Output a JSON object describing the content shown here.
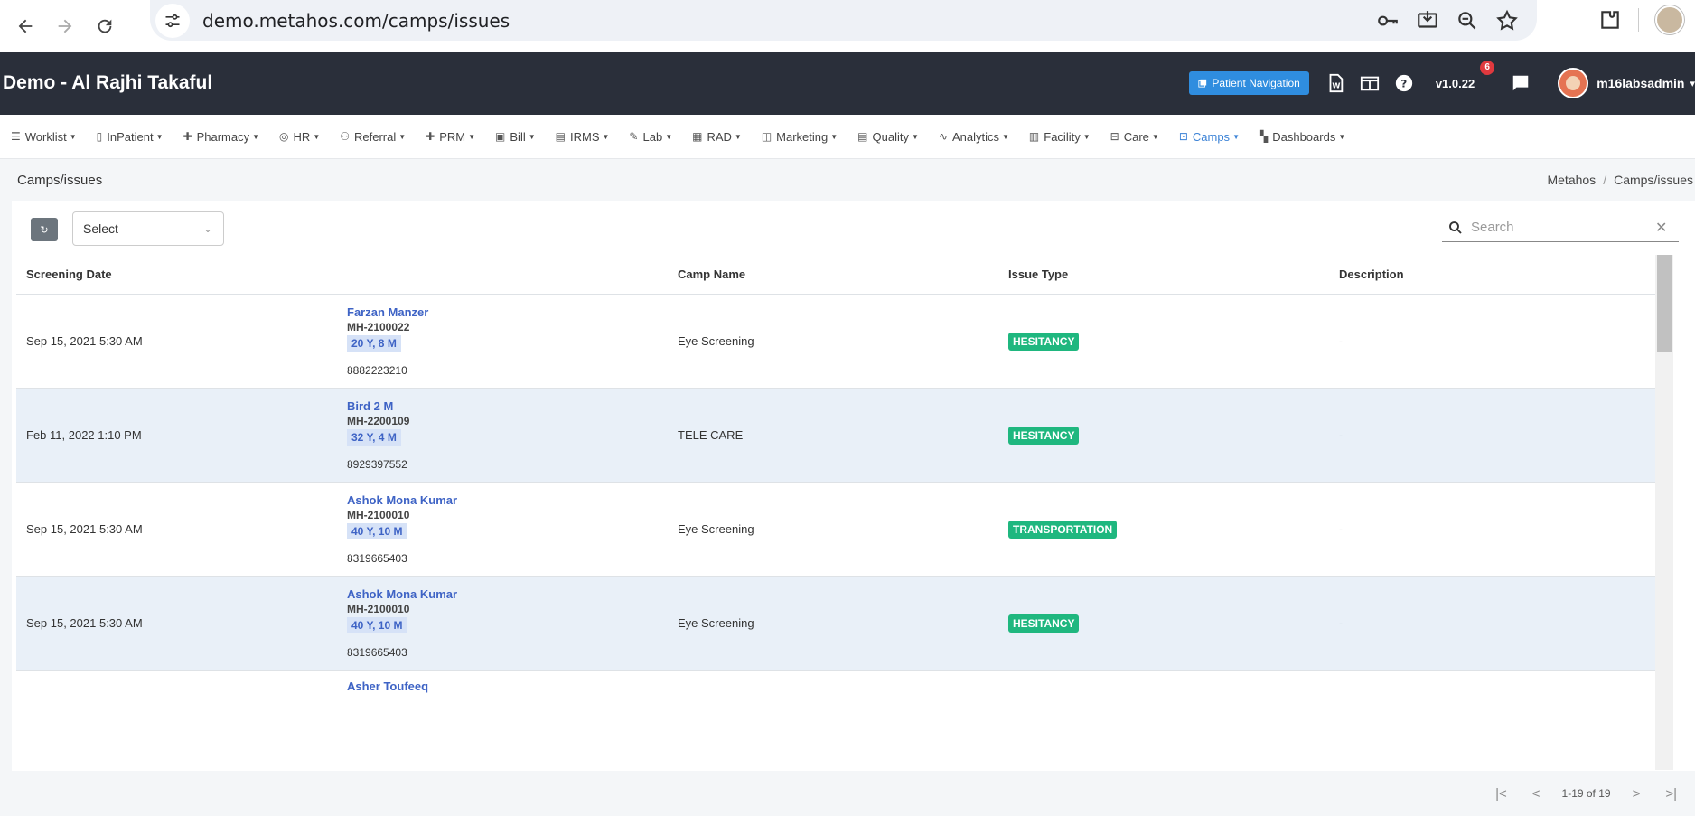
{
  "browser": {
    "url": "demo.metahos.com/camps/issues"
  },
  "header": {
    "title": "Demo - Al Rajhi Takaful",
    "patient_nav_label": "Patient Navigation",
    "version": "v1.0.22",
    "notification_count": "6",
    "username": "m16labsadmin"
  },
  "menu": [
    {
      "label": "Worklist",
      "icon": "list-icon"
    },
    {
      "label": "InPatient",
      "icon": "bed-icon"
    },
    {
      "label": "Pharmacy",
      "icon": "plus-icon"
    },
    {
      "label": "HR",
      "icon": "user-circle-icon"
    },
    {
      "label": "Referral",
      "icon": "users-icon"
    },
    {
      "label": "PRM",
      "icon": "plus-icon"
    },
    {
      "label": "Bill",
      "icon": "receipt-icon"
    },
    {
      "label": "IRMS",
      "icon": "list-box-icon"
    },
    {
      "label": "Lab",
      "icon": "pen-icon"
    },
    {
      "label": "RAD",
      "icon": "film-icon"
    },
    {
      "label": "Marketing",
      "icon": "bag-icon"
    },
    {
      "label": "Quality",
      "icon": "list-box-icon"
    },
    {
      "label": "Analytics",
      "icon": "pulse-icon"
    },
    {
      "label": "Facility",
      "icon": "building-icon"
    },
    {
      "label": "Care",
      "icon": "bus-icon"
    },
    {
      "label": "Camps",
      "icon": "briefcase-icon"
    },
    {
      "label": "Dashboards",
      "icon": "grid-icon"
    }
  ],
  "page": {
    "title": "Camps/issues",
    "breadcrumb_root": "Metahos",
    "breadcrumb_current": "Camps/issues"
  },
  "toolbar": {
    "select_value": "Select",
    "search_placeholder": "Search"
  },
  "table": {
    "columns": [
      "Screening Date",
      "",
      "Camp Name",
      "Issue Type",
      "Description"
    ],
    "rows": [
      {
        "date": "Sep 15, 2021 5:30 AM",
        "name": "Farzan Manzer",
        "id": "MH-2100022",
        "age": "20 Y, 8 M",
        "phone": "8882223210",
        "camp": "Eye Screening",
        "issue": "HESITANCY",
        "description": "-"
      },
      {
        "date": "Feb 11, 2022 1:10 PM",
        "name": "Bird 2 M",
        "id": "MH-2200109",
        "age": "32 Y, 4 M",
        "phone": "8929397552",
        "camp": "TELE CARE",
        "issue": "HESITANCY",
        "description": "-"
      },
      {
        "date": "Sep 15, 2021 5:30 AM",
        "name": "Ashok Mona Kumar",
        "id": "MH-2100010",
        "age": "40 Y, 10 M",
        "phone": "8319665403",
        "camp": "Eye Screening",
        "issue": "TRANSPORTATION",
        "description": "-"
      },
      {
        "date": "Sep 15, 2021 5:30 AM",
        "name": "Ashok Mona Kumar",
        "id": "MH-2100010",
        "age": "40 Y, 10 M",
        "phone": "8319665403",
        "camp": "Eye Screening",
        "issue": "HESITANCY",
        "description": "-"
      },
      {
        "date": "",
        "name": "Asher Toufeeq",
        "id": "",
        "age": "",
        "phone": "",
        "camp": "",
        "issue": "",
        "description": ""
      }
    ]
  },
  "pager": {
    "range": "1-19 of 19"
  }
}
